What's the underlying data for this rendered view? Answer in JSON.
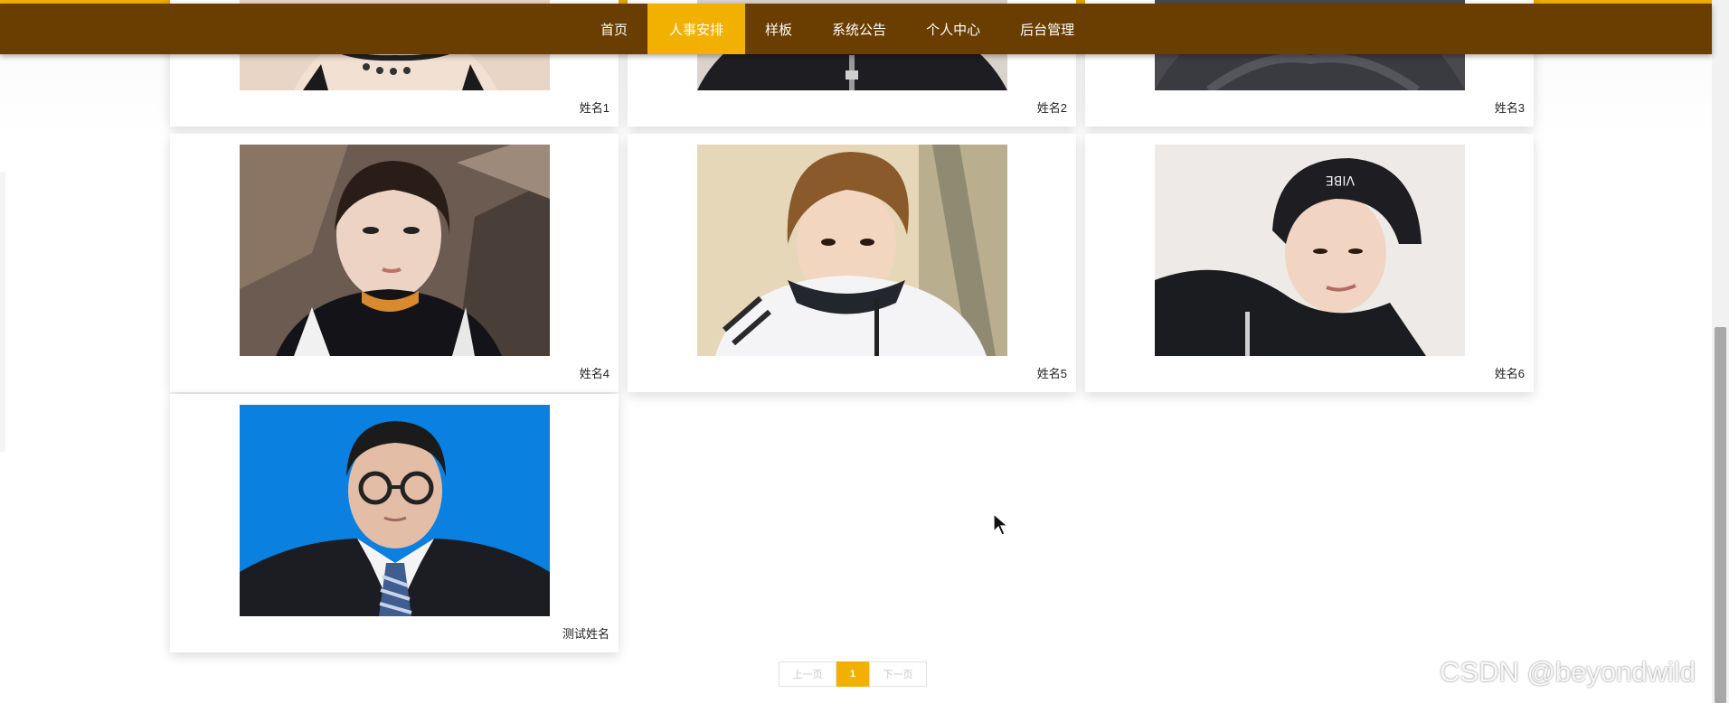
{
  "nav": {
    "items": [
      {
        "label": "首页"
      },
      {
        "label": "人事安排"
      },
      {
        "label": "样板"
      },
      {
        "label": "系统公告"
      },
      {
        "label": "个人中心"
      },
      {
        "label": "后台管理"
      }
    ],
    "active_index": 1
  },
  "cards": [
    {
      "name": "姓名1",
      "icon": "photo-female-portrait"
    },
    {
      "name": "姓名2",
      "icon": "photo-male-hoodie"
    },
    {
      "name": "姓名3",
      "icon": "photo-male-sweater"
    },
    {
      "name": "姓名4",
      "icon": "photo-female-selfie"
    },
    {
      "name": "姓名5",
      "icon": "photo-male-jacket"
    },
    {
      "name": "姓名6",
      "icon": "photo-male-cap"
    },
    {
      "name": "测试姓名",
      "icon": "photo-male-id-blue-background"
    }
  ],
  "pagination": {
    "prev_label": "上一页",
    "current_page": "1",
    "next_label": "下一页"
  },
  "watermark": "CSDN @beyondwild",
  "colors": {
    "nav_bg": "#6a3d00",
    "accent": "#f2b100",
    "id_photo_bg": "#0a80e0"
  }
}
